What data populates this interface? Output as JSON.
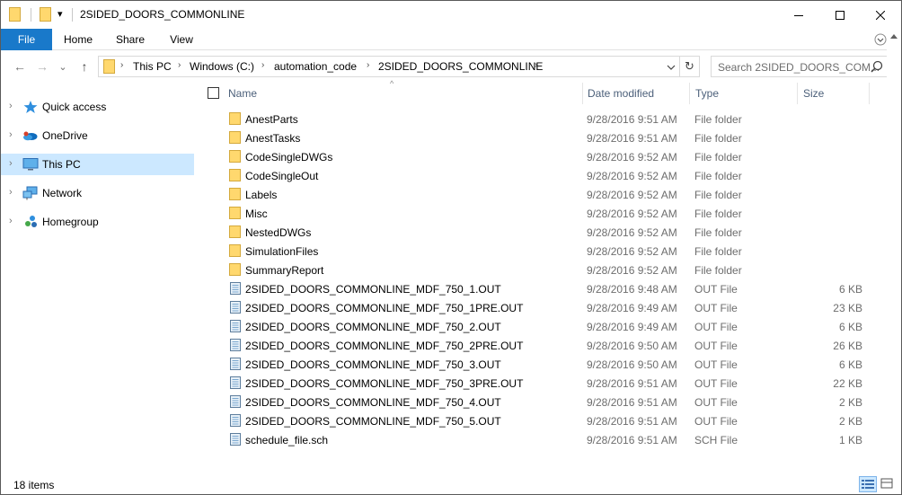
{
  "window": {
    "title": "2SIDED_DOORS_COMMONLINE",
    "qat_dropdown": "▾",
    "controls": {
      "minimize": "—",
      "maximize": "☐",
      "close": "✕"
    }
  },
  "ribbon": {
    "tabs": [
      {
        "label": "File",
        "active": true
      },
      {
        "label": "Home"
      },
      {
        "label": "Share"
      },
      {
        "label": "View"
      }
    ]
  },
  "navigation": {
    "back": "←",
    "forward": "→",
    "recent": "⌄",
    "up": "↑",
    "breadcrumb": [
      "This PC",
      "Windows (C:)",
      "automation_code",
      "2SIDED_DOORS_COMMONLINE"
    ],
    "separator": "›",
    "refresh": "↻",
    "search_placeholder": "Search 2SIDED_DOORS_COM..."
  },
  "nav_pane": {
    "items": [
      {
        "label": "Quick access",
        "icon": "star-icon",
        "selected": false
      },
      {
        "label": "OneDrive",
        "icon": "onedrive-icon",
        "selected": false
      },
      {
        "label": "This PC",
        "icon": "computer-icon",
        "selected": true
      },
      {
        "label": "Network",
        "icon": "network-icon",
        "selected": false
      },
      {
        "label": "Homegroup",
        "icon": "homegroup-icon",
        "selected": false
      }
    ],
    "chevron": "›"
  },
  "columns": {
    "name": "Name",
    "date": "Date modified",
    "type": "Type",
    "size": "Size",
    "sort_indicator": "^"
  },
  "files": [
    {
      "name": "AnestParts",
      "date": "9/28/2016 9:51 AM",
      "type": "File folder",
      "size": "",
      "kind": "folder"
    },
    {
      "name": "AnestTasks",
      "date": "9/28/2016 9:51 AM",
      "type": "File folder",
      "size": "",
      "kind": "folder"
    },
    {
      "name": "CodeSingleDWGs",
      "date": "9/28/2016 9:52 AM",
      "type": "File folder",
      "size": "",
      "kind": "folder"
    },
    {
      "name": "CodeSingleOut",
      "date": "9/28/2016 9:52 AM",
      "type": "File folder",
      "size": "",
      "kind": "folder"
    },
    {
      "name": "Labels",
      "date": "9/28/2016 9:52 AM",
      "type": "File folder",
      "size": "",
      "kind": "folder"
    },
    {
      "name": "Misc",
      "date": "9/28/2016 9:52 AM",
      "type": "File folder",
      "size": "",
      "kind": "folder"
    },
    {
      "name": "NestedDWGs",
      "date": "9/28/2016 9:52 AM",
      "type": "File folder",
      "size": "",
      "kind": "folder"
    },
    {
      "name": "SimulationFiles",
      "date": "9/28/2016 9:52 AM",
      "type": "File folder",
      "size": "",
      "kind": "folder"
    },
    {
      "name": "SummaryReport",
      "date": "9/28/2016 9:52 AM",
      "type": "File folder",
      "size": "",
      "kind": "folder"
    },
    {
      "name": "2SIDED_DOORS_COMMONLINE_MDF_750_1.OUT",
      "date": "9/28/2016 9:48 AM",
      "type": "OUT File",
      "size": "6 KB",
      "kind": "file"
    },
    {
      "name": "2SIDED_DOORS_COMMONLINE_MDF_750_1PRE.OUT",
      "date": "9/28/2016 9:49 AM",
      "type": "OUT File",
      "size": "23 KB",
      "kind": "file"
    },
    {
      "name": "2SIDED_DOORS_COMMONLINE_MDF_750_2.OUT",
      "date": "9/28/2016 9:49 AM",
      "type": "OUT File",
      "size": "6 KB",
      "kind": "file"
    },
    {
      "name": "2SIDED_DOORS_COMMONLINE_MDF_750_2PRE.OUT",
      "date": "9/28/2016 9:50 AM",
      "type": "OUT File",
      "size": "26 KB",
      "kind": "file"
    },
    {
      "name": "2SIDED_DOORS_COMMONLINE_MDF_750_3.OUT",
      "date": "9/28/2016 9:50 AM",
      "type": "OUT File",
      "size": "6 KB",
      "kind": "file"
    },
    {
      "name": "2SIDED_DOORS_COMMONLINE_MDF_750_3PRE.OUT",
      "date": "9/28/2016 9:51 AM",
      "type": "OUT File",
      "size": "22 KB",
      "kind": "file"
    },
    {
      "name": "2SIDED_DOORS_COMMONLINE_MDF_750_4.OUT",
      "date": "9/28/2016 9:51 AM",
      "type": "OUT File",
      "size": "2 KB",
      "kind": "file"
    },
    {
      "name": "2SIDED_DOORS_COMMONLINE_MDF_750_5.OUT",
      "date": "9/28/2016 9:51 AM",
      "type": "OUT File",
      "size": "2 KB",
      "kind": "file"
    },
    {
      "name": "schedule_file.sch",
      "date": "9/28/2016 9:51 AM",
      "type": "SCH File",
      "size": "1 KB",
      "kind": "file"
    }
  ],
  "status": {
    "item_count": "18 items"
  },
  "colors": {
    "accent": "#1979ca",
    "selection": "#cce8ff",
    "folder": "#ffd86e",
    "header_text": "#4c607a",
    "muted_text": "#6d6d6d"
  }
}
